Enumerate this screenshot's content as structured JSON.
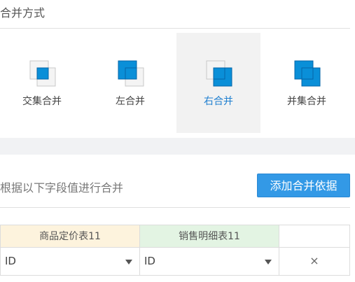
{
  "merge_mode": {
    "title": "合并方式",
    "options": [
      {
        "label": "交集合并",
        "icon": "intersection-merge-icon",
        "selected": false
      },
      {
        "label": "左合并",
        "icon": "left-merge-icon",
        "selected": false
      },
      {
        "label": "右合并",
        "icon": "right-merge-icon",
        "selected": true
      },
      {
        "label": "并集合并",
        "icon": "union-merge-icon",
        "selected": false
      }
    ]
  },
  "merge_basis": {
    "title": "根据以下字段值进行合并",
    "add_button_label": "添加合并依据"
  },
  "grid": {
    "headers": [
      "商品定价表11",
      "销售明细表11"
    ],
    "rows": [
      {
        "left_field": "ID",
        "right_field": "ID",
        "remove": "×"
      }
    ]
  },
  "colors": {
    "accent": "#1f7fd0",
    "button": "#3399e6",
    "icon_fill": "#0a8fd8",
    "left_header_bg": "#fdf3dd",
    "right_header_bg": "#e3f4e3"
  }
}
